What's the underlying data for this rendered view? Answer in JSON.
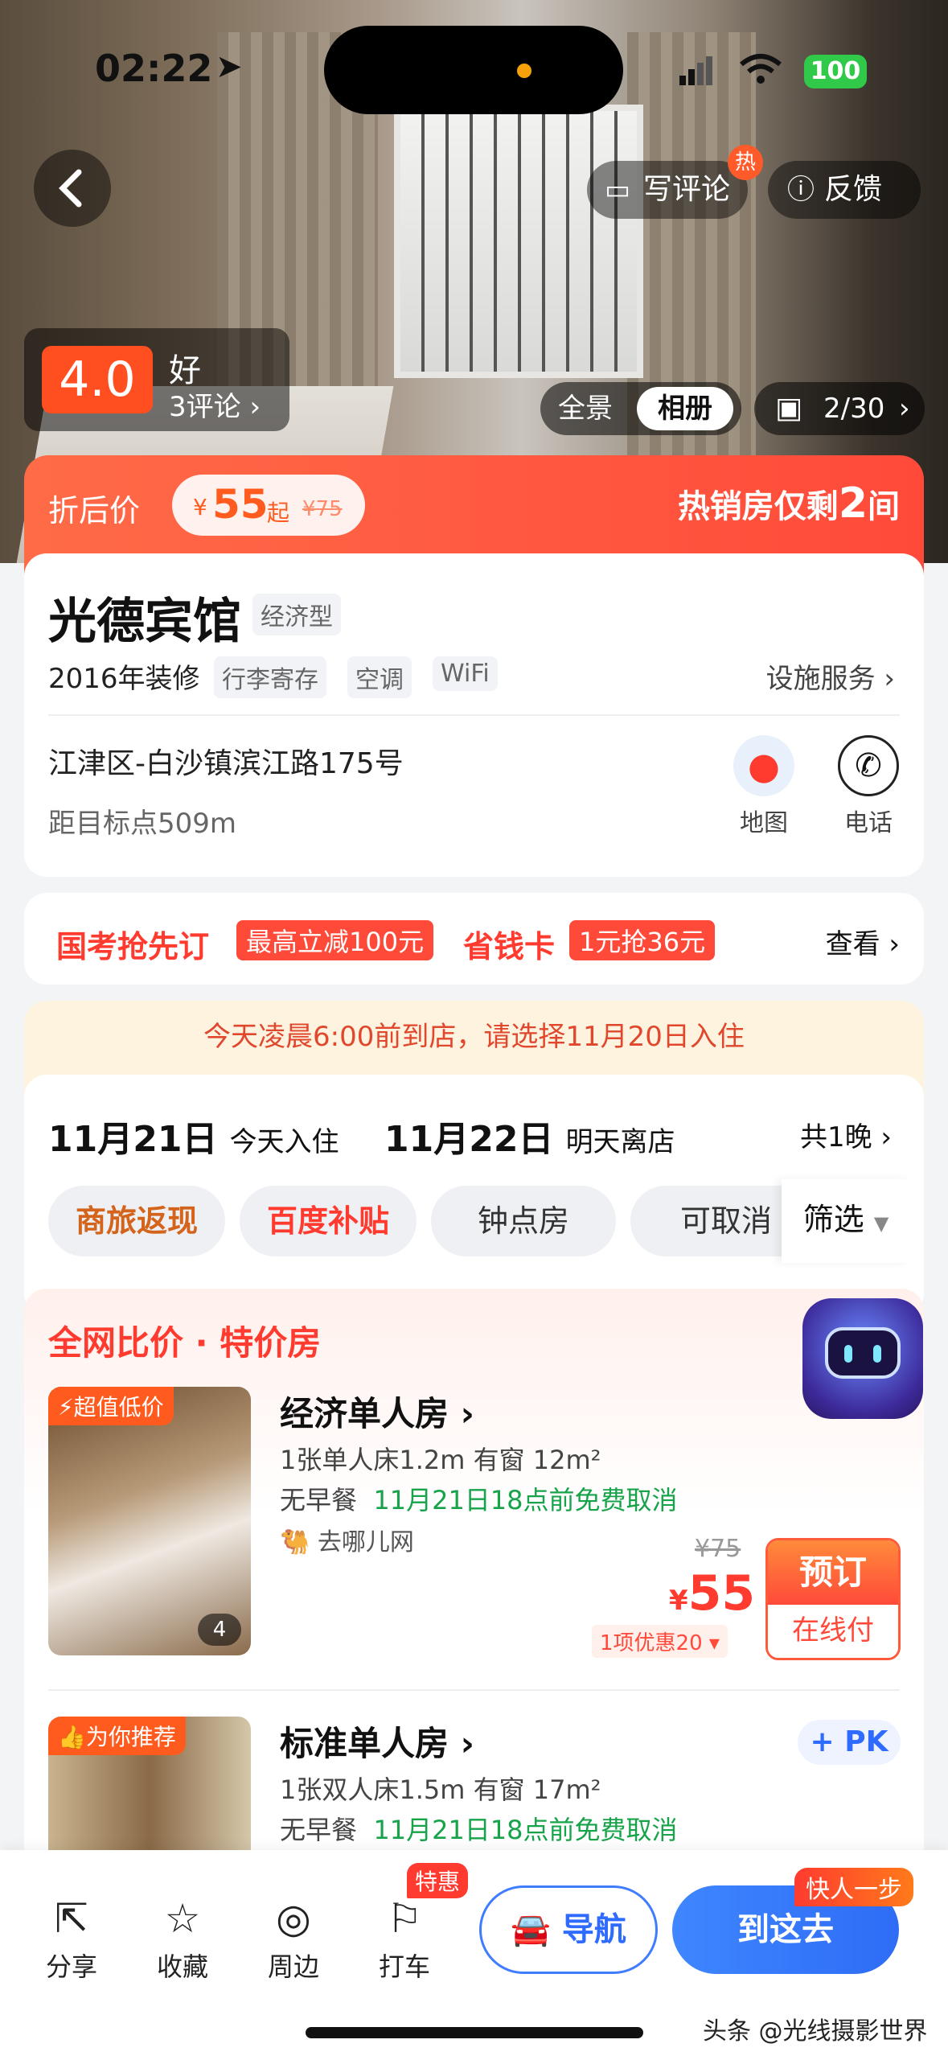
{
  "status_bar": {
    "time": "02:22",
    "battery": "100"
  },
  "header": {
    "write_review": "写评论",
    "hot_badge": "热",
    "feedback": "反馈"
  },
  "rating": {
    "score": "4.0",
    "label": "好",
    "reviews": "3评论"
  },
  "gallery": {
    "panorama": "全景",
    "album": "相册",
    "count": "2/30"
  },
  "price_band": {
    "label": "折后价",
    "currency": "¥",
    "price": "55",
    "suffix": "起",
    "original": "¥75",
    "scarcity_pre": "热销房仅剩",
    "scarcity_num": "2",
    "scarcity_post": "间"
  },
  "hotel": {
    "name": "光德宾馆",
    "type": "经济型",
    "renovated": "2016年装修",
    "facilities": [
      "行李寄存",
      "空调",
      "WiFi"
    ],
    "facility_link": "设施服务",
    "address": "江津区-白沙镇滨江路175号",
    "distance": "距目标点509m",
    "map_label": "地图",
    "phone_label": "电话"
  },
  "promo": {
    "title1": "国考抢先订",
    "badge1": "最高立减100元",
    "title2": "省钱卡",
    "badge2": "1元抢36元",
    "view": "查看"
  },
  "notice": "今天凌晨6:00前到店，请选择11月20日入住",
  "dates": {
    "checkin": "11月21日",
    "checkin_label": "今天入住",
    "checkout": "11月22日",
    "checkout_label": "明天离店",
    "nights": "共1晚"
  },
  "filters": {
    "chips": [
      "商旅返现",
      "百度补贴",
      "钟点房",
      "可取消"
    ],
    "filter_label": "筛选"
  },
  "section": {
    "title": "全网比价 · 特价房"
  },
  "rooms": [
    {
      "badge": "超值低价",
      "name": "经济单人房",
      "bed": "1张单人床1.2m 有窗 12m²",
      "meal": "无早餐",
      "cancel": "11月21日18点前免费取消",
      "source": "去哪儿网",
      "orig": "¥75",
      "currency": "¥",
      "price": "55",
      "discount": "1项优惠20",
      "book": "预订",
      "pay": "在线付",
      "photo_count": "4"
    },
    {
      "badge": "为你推荐",
      "name": "标准单人房",
      "bed": "1张双人床1.5m 有窗 17m²",
      "meal": "无早餐",
      "cancel": "11月21日18点前免费取消",
      "pk": "PK"
    }
  ],
  "bottom_bar": {
    "share": "分享",
    "favorite": "收藏",
    "nearby": "周边",
    "taxi": "打车",
    "taxi_badge": "特惠",
    "navigate": "导航",
    "go": "到这去",
    "go_badge": "快人一步"
  },
  "watermark": "头条 @光线摄影世界"
}
